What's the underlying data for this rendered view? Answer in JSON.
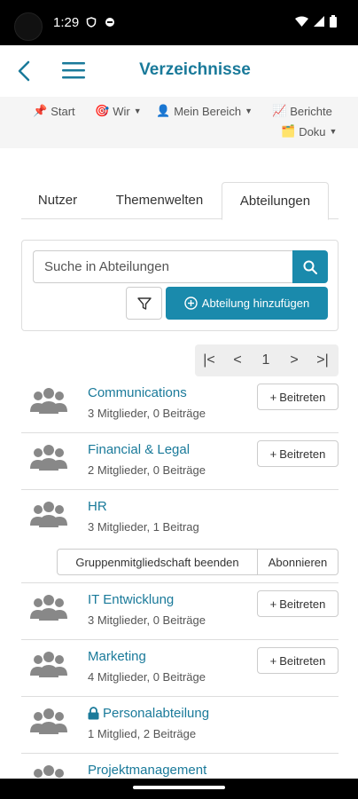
{
  "status": {
    "time": "1:29"
  },
  "appbar": {
    "title": "Verzeichnisse"
  },
  "nav": {
    "start": "Start",
    "wir": "Wir",
    "mein_bereich": "Mein Bereich",
    "berichte": "Berichte",
    "doku": "Doku",
    "icons": {
      "start": "📌",
      "wir": "🎯",
      "mein_bereich": "👤",
      "berichte": "📈",
      "doku": "🗂️"
    }
  },
  "tabs": [
    {
      "label": "Nutzer"
    },
    {
      "label": "Themenwelten"
    },
    {
      "label": "Abteilungen"
    }
  ],
  "search": {
    "placeholder": "Suche in Abteilungen",
    "add_label": "Abteilung hinzufügen"
  },
  "pager": {
    "first": "|<",
    "prev": "<",
    "page": "1",
    "next": ">",
    "last": ">|"
  },
  "departments": [
    {
      "name": "Communications",
      "meta": "3 Mitglieder, 0 Beiträge",
      "action": "Beitreten"
    },
    {
      "name": "Financial & Legal",
      "meta": "2 Mitglieder, 0 Beiträge",
      "action": "Beitreten"
    },
    {
      "name": "HR",
      "meta": "3 Mitglieder, 1 Beitrag"
    },
    {
      "name": "IT Entwicklung",
      "meta": "3 Mitglieder, 0 Beiträge",
      "action": "Beitreten"
    },
    {
      "name": "Marketing",
      "meta": "4 Mitglieder, 0 Beiträge",
      "action": "Beitreten"
    },
    {
      "name": "Personalabteilung",
      "meta": "1 Mitglied, 2 Beiträge",
      "locked": true
    },
    {
      "name": "Projektmanagement"
    }
  ],
  "hr_actions": {
    "leave": "Gruppenmitgliedschaft beenden",
    "subscribe": "Abonnieren"
  },
  "colors": {
    "accent": "#1a8aac",
    "link": "#1a7a9a"
  }
}
